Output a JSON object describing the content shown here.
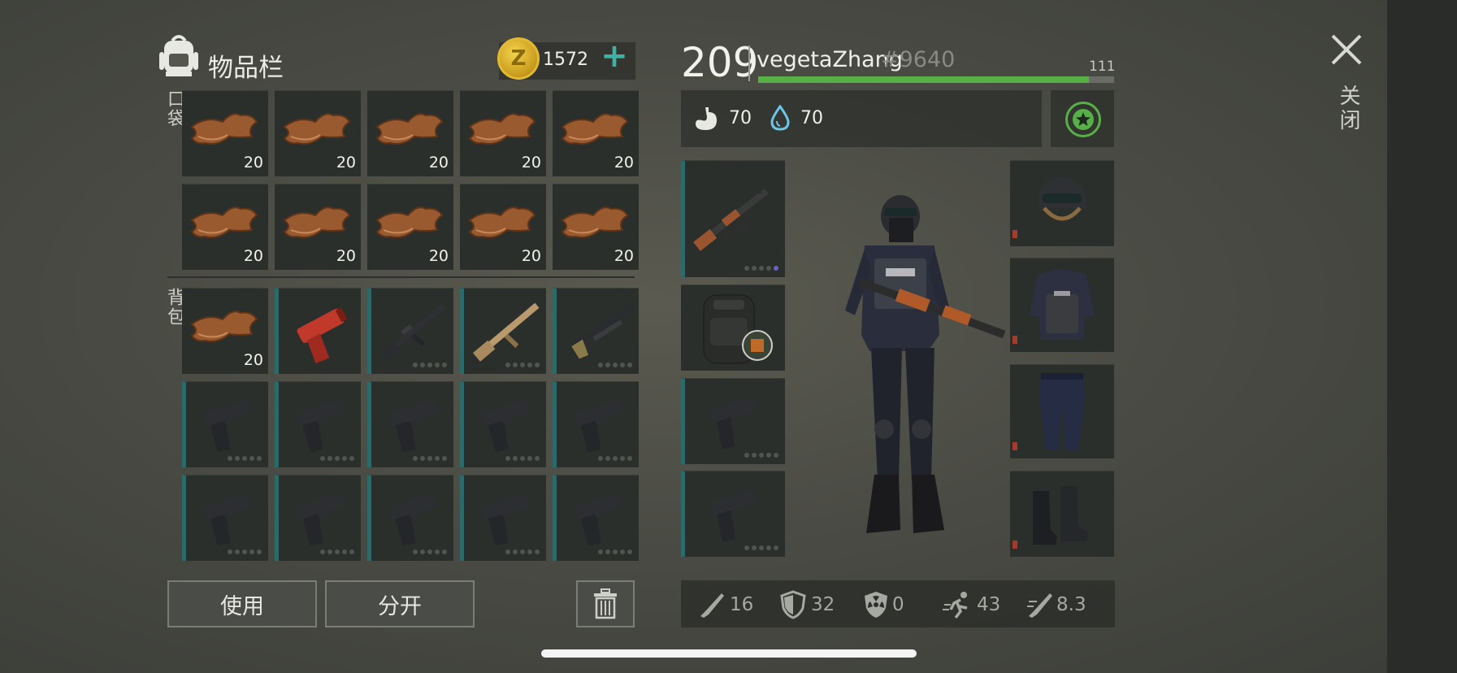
{
  "inventory": {
    "title": "物品栏",
    "currency_icon_letter": "Z",
    "currency_amount": "1572",
    "add_currency_label": "+",
    "pocket_label": "口袋",
    "backpack_label": "背包",
    "pocket_items": [
      {
        "icon": "leather-icon",
        "qty": "20"
      },
      {
        "icon": "leather-icon",
        "qty": "20"
      },
      {
        "icon": "leather-icon",
        "qty": "20"
      },
      {
        "icon": "leather-icon",
        "qty": "20"
      },
      {
        "icon": "leather-icon",
        "qty": "20"
      },
      {
        "icon": "leather-icon",
        "qty": "20"
      },
      {
        "icon": "leather-icon",
        "qty": "20"
      },
      {
        "icon": "leather-icon",
        "qty": "20"
      },
      {
        "icon": "leather-icon",
        "qty": "20"
      },
      {
        "icon": "leather-icon",
        "qty": "20"
      }
    ],
    "backpack_items": [
      {
        "icon": "leather-icon",
        "qty": "20"
      },
      {
        "icon": "flare-gun-icon"
      },
      {
        "icon": "assault-rifle-icon"
      },
      {
        "icon": "scar-rifle-icon"
      },
      {
        "icon": "shotgun-icon"
      },
      {
        "icon": "pistol-icon"
      },
      {
        "icon": "pistol-icon"
      },
      {
        "icon": "pistol-icon"
      },
      {
        "icon": "pistol-icon"
      },
      {
        "icon": "pistol-icon"
      },
      {
        "icon": "pistol-icon"
      },
      {
        "icon": "pistol-icon"
      },
      {
        "icon": "pistol-icon"
      },
      {
        "icon": "pistol-icon"
      },
      {
        "icon": "pistol-icon"
      }
    ],
    "use_button": "使用",
    "split_button": "分开"
  },
  "profile": {
    "level": "209",
    "name": "vegetaZhang",
    "tag": "#9640",
    "xp_value": "111",
    "xp_fraction": 0.93,
    "hunger": "70",
    "thirst": "70"
  },
  "stats": {
    "attack": "16",
    "defense": "32",
    "radiation": "0",
    "speed": "43",
    "stealth": "8.3"
  },
  "close_label": "关闭",
  "colors": {
    "accent_teal": "#3fb0a4",
    "xp_green": "#56b046",
    "coin_gold": "#e2b932",
    "durability_red": "#a83a2a"
  }
}
